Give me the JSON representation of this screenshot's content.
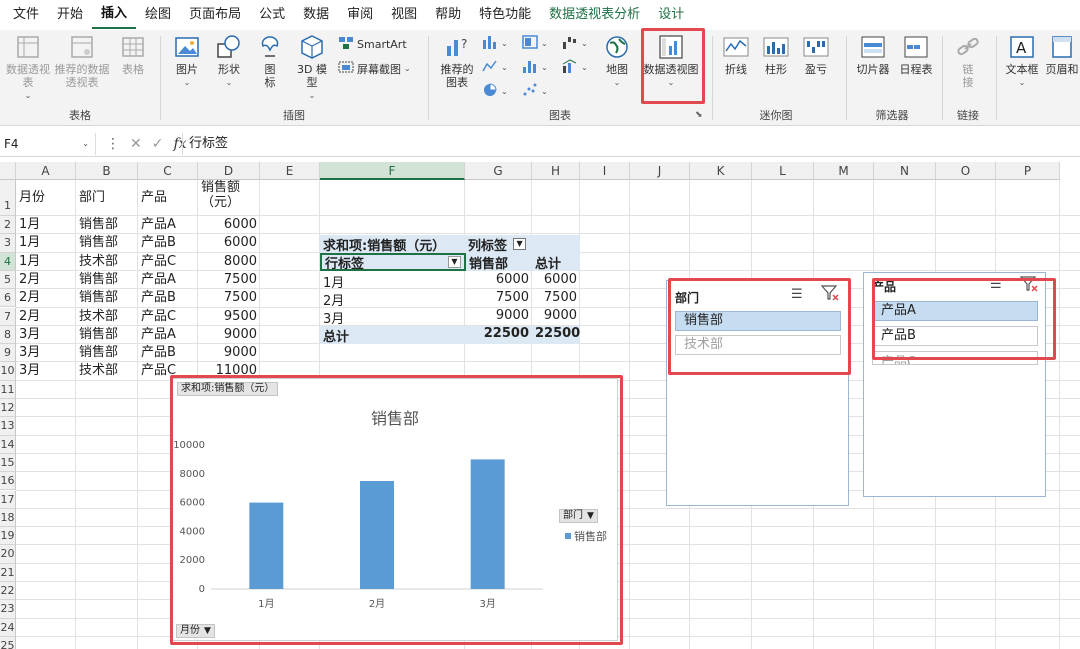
{
  "menu": [
    "文件",
    "开始",
    "插入",
    "绘图",
    "页面布局",
    "公式",
    "数据",
    "审阅",
    "视图",
    "帮助",
    "特色功能",
    "数据透视表分析",
    "设计"
  ],
  "ribbon": {
    "table_group": {
      "label": "表格",
      "pivot": "数据透视表",
      "recommended_pivot": "推荐的数据透视表",
      "table": "表格"
    },
    "illus_group": {
      "label": "插图",
      "picture": "图片",
      "shapes": "形状",
      "icons": "图标",
      "model3d": "3D 模型",
      "smartart": "SmartArt",
      "screenshot": "屏幕截图"
    },
    "charts_group": {
      "label": "图表",
      "recommended": "推荐的图表",
      "map": "地图",
      "pivot_chart": "数据透视图"
    },
    "spark_group": {
      "label": "迷你图",
      "line": "折线",
      "column": "柱形",
      "winloss": "盈亏"
    },
    "filter_group": {
      "label": "筛选器",
      "slicer": "切片器",
      "timeline": "日程表"
    },
    "link_group": {
      "label": "链接",
      "link": "链接"
    },
    "text_group": {
      "textbox": "文本框",
      "header": "页眉和"
    }
  },
  "formula": {
    "namebox": "F4",
    "value": "行标签"
  },
  "columns": [
    "A",
    "B",
    "C",
    "D",
    "E",
    "F",
    "G",
    "H",
    "I",
    "J",
    "K",
    "L",
    "M",
    "N",
    "O",
    "P"
  ],
  "rows": [
    "1",
    "2",
    "3",
    "4",
    "5",
    "6",
    "7",
    "8",
    "9",
    "10",
    "11",
    "12",
    "13",
    "14",
    "15",
    "16",
    "17",
    "18",
    "19",
    "20",
    "21",
    "22",
    "23",
    "24",
    "25"
  ],
  "source": {
    "headers": [
      "月份",
      "部门",
      "产品",
      "销售额\n（元）"
    ],
    "rows": [
      [
        "1月",
        "销售部",
        "产品A",
        "6000"
      ],
      [
        "1月",
        "销售部",
        "产品B",
        "6000"
      ],
      [
        "1月",
        "技术部",
        "产品C",
        "8000"
      ],
      [
        "2月",
        "销售部",
        "产品A",
        "7500"
      ],
      [
        "2月",
        "销售部",
        "产品B",
        "7500"
      ],
      [
        "2月",
        "技术部",
        "产品C",
        "9500"
      ],
      [
        "3月",
        "销售部",
        "产品A",
        "9000"
      ],
      [
        "3月",
        "销售部",
        "产品B",
        "9000"
      ],
      [
        "3月",
        "技术部",
        "产品C",
        "11000"
      ]
    ]
  },
  "pivot": {
    "sum_label": "求和项:销售额（元）",
    "col_label": "列标签",
    "row_label": "行标签",
    "col1": "销售部",
    "total_col": "总计",
    "rows": [
      [
        "1月",
        "6000",
        "6000"
      ],
      [
        "2月",
        "7500",
        "7500"
      ],
      [
        "3月",
        "9000",
        "9000"
      ]
    ],
    "total_row": [
      "总计",
      "22500",
      "22500"
    ]
  },
  "slicer_dept": {
    "title": "部门",
    "items": [
      {
        "label": "销售部",
        "on": true
      },
      {
        "label": "技术部",
        "on": false
      }
    ]
  },
  "slicer_prod": {
    "title": "产品",
    "items": [
      {
        "label": "产品A",
        "on": true
      },
      {
        "label": "产品B",
        "on": false
      },
      {
        "label": "产品C",
        "on": false
      }
    ]
  },
  "chart_data": {
    "type": "bar",
    "title": "销售部",
    "categories": [
      "1月",
      "2月",
      "3月"
    ],
    "series": [
      {
        "name": "销售部",
        "values": [
          6000,
          7500,
          9000
        ]
      }
    ],
    "ylim": [
      0,
      10000
    ],
    "yticks": [
      0,
      2000,
      4000,
      6000,
      8000,
      10000
    ],
    "value_field_button": "求和项:销售额（元）",
    "legend_field_button": "部门",
    "axis_field_button": "月份",
    "legend_position": "right",
    "bar_color": "#5b9bd5",
    "grid": false
  },
  "colors": {
    "accent": "#1e7145",
    "highlight": "#e2484e",
    "pivot_header": "#dce9f5"
  }
}
